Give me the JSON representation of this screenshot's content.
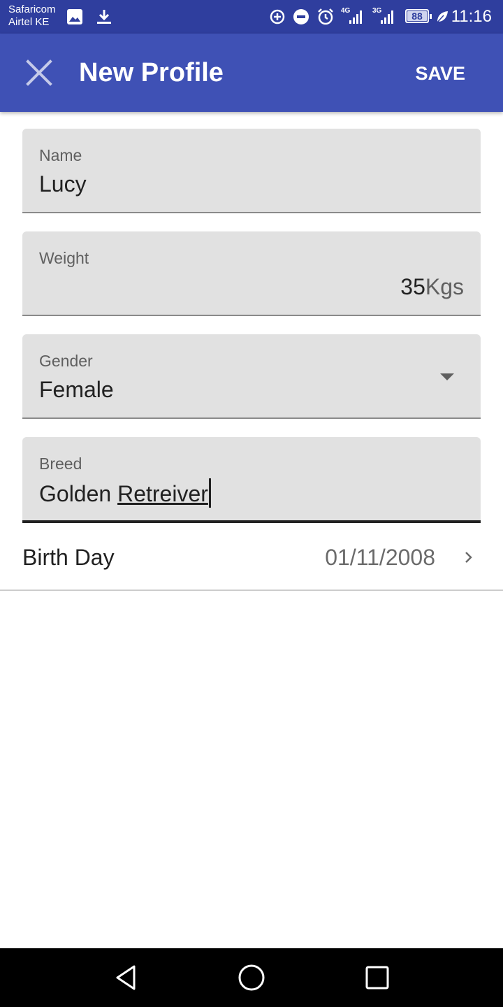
{
  "status_bar": {
    "carrier_1": "Safaricom",
    "carrier_2": "Airtel KE",
    "network_1": "4G",
    "network_2": "3G",
    "battery": "88",
    "time": "11:16",
    "icons": [
      "image-icon",
      "download-icon",
      "data-saver-icon",
      "do-not-disturb-icon",
      "alarm-icon",
      "signal-icon",
      "battery-icon",
      "leaf-icon"
    ]
  },
  "app_bar": {
    "title": "New Profile",
    "save_label": "SAVE",
    "close_icon": "close-icon"
  },
  "form": {
    "name": {
      "label": "Name",
      "value": "Lucy"
    },
    "weight": {
      "label": "Weight",
      "value": "35",
      "unit": "Kgs"
    },
    "gender": {
      "label": "Gender",
      "value": "Female"
    },
    "breed": {
      "label": "Breed",
      "value_word1": "Golden",
      "value_word2": "Retreiver"
    },
    "birthday": {
      "label": "Birth Day",
      "value": "01/11/2008"
    }
  },
  "colors": {
    "status_bar": "#2f3e9e",
    "app_bar": "#3f51b5",
    "field_bg": "#e1e1e1"
  }
}
